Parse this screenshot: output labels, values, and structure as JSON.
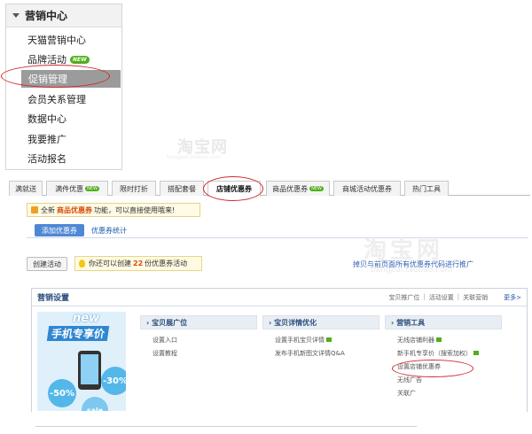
{
  "menu": {
    "title": "营销中心",
    "items": [
      {
        "label": "天猫营销中心"
      },
      {
        "label": "品牌活动",
        "badge": "NEW"
      },
      {
        "label": "促销管理"
      },
      {
        "label": "会员关系管理"
      },
      {
        "label": "数据中心"
      },
      {
        "label": "我要推广"
      },
      {
        "label": "活动报名"
      }
    ]
  },
  "watermark": {
    "text": "淘宝网",
    "url": "bangpai.taobao.com"
  },
  "tabs": [
    {
      "label": "满就送"
    },
    {
      "label": "满件优惠",
      "badge": "NEW"
    },
    {
      "label": "限时打折"
    },
    {
      "label": "搭配套餐"
    },
    {
      "label": "店铺优惠券"
    },
    {
      "label": "商品优惠券",
      "badge": "NEW"
    },
    {
      "label": "商城活动优惠券"
    },
    {
      "label": "热门工具"
    }
  ],
  "notice": {
    "prefix": "全新",
    "highlight": "商品优惠券",
    "suffix": "功能，可以直接使用哦来!"
  },
  "subnav": {
    "add_button": "添加优惠券",
    "stats_link": "优惠券统计"
  },
  "create": {
    "button": "创建活动",
    "tip_prefix": "你还可以创建",
    "count": "22",
    "tip_suffix": "份优惠券活动"
  },
  "right_link": "掉贝与前页面所有优惠券代码进行推广",
  "panel": {
    "title": "营销设置",
    "links": [
      "宝贝推广位",
      "活动设置",
      "关联营销"
    ],
    "more": "更多>",
    "promo": {
      "new": "new",
      "title": "手机专享价",
      "badge1": "-50%",
      "badge2": "-30%",
      "badge3": "sale"
    },
    "columns": [
      {
        "title": "宝贝展广位",
        "items": [
          "设置入口",
          "设置教程"
        ]
      },
      {
        "title": "宝贝详情优化",
        "items": [
          "设置手机宝贝详情",
          "发布手机新图文详情Q&A"
        ]
      },
      {
        "title": "营销工具",
        "items": [
          "无线店铺利器",
          "新手机专享价（搜索加权）",
          "设置店铺优惠券",
          "无线广告",
          "关联广"
        ]
      }
    ]
  },
  "colors": {
    "accent": "#4e88d4",
    "highlight": "#d84b0c",
    "badge": "#4fae1c",
    "annotation": "#d12a2a"
  }
}
